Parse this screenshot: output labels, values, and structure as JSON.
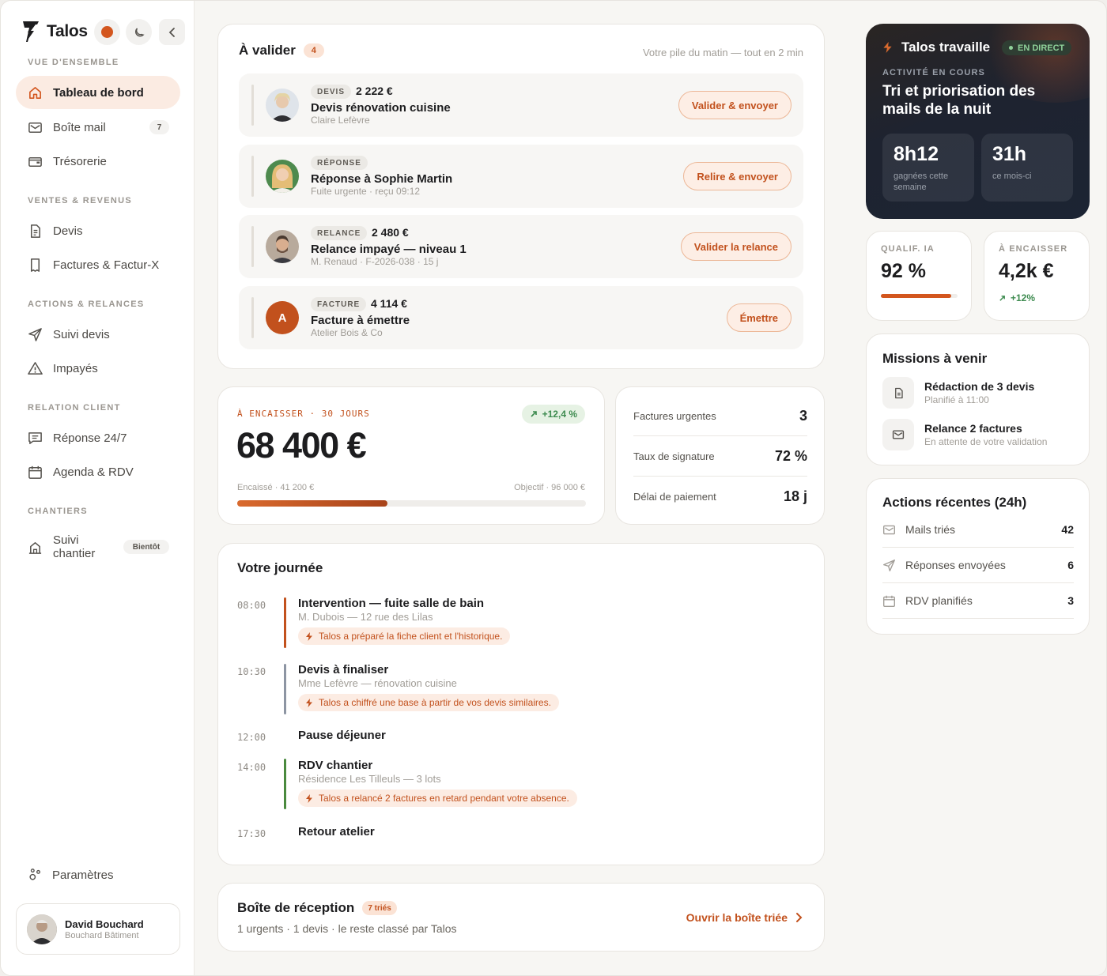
{
  "app": {
    "name": "Talos"
  },
  "sidebar": {
    "sections": [
      "VUE D'ENSEMBLE",
      "VENTES & REVENUS",
      "ACTIONS & RELANCES",
      "RELATION CLIENT",
      "CHANTIERS"
    ],
    "items": [
      {
        "label": "Tableau de bord"
      },
      {
        "label": "Boîte mail",
        "badge": "7"
      },
      {
        "label": "Trésorerie"
      },
      {
        "label": "Devis"
      },
      {
        "label": "Factures & Factur-X"
      },
      {
        "label": "Suivi devis"
      },
      {
        "label": "Impayés"
      },
      {
        "label": "Réponse 24/7"
      },
      {
        "label": "Agenda & RDV"
      },
      {
        "label": "Suivi\nchantier",
        "badge": "Bientôt"
      }
    ],
    "settings_label": "Paramètres",
    "user": {
      "name": "David Bouchard",
      "company": "Bouchard Bâtiment"
    }
  },
  "validate": {
    "title": "À valider",
    "count": "4",
    "hint": "Votre pile du matin — tout en 2 min",
    "rows": [
      {
        "tag": "DEVIS",
        "amount": "2 222 €",
        "title": "Devis rénovation cuisine",
        "sub": "Claire Lefèvre",
        "button": "Valider & envoyer"
      },
      {
        "tag": "RÉPONSE",
        "amount": "",
        "title": "Réponse à Sophie Martin",
        "sub": "Fuite urgente · reçu 09:12",
        "button": "Relire & envoyer"
      },
      {
        "tag": "RELANCE",
        "amount": "2 480 €",
        "title": "Relance impayé — niveau 1",
        "sub": "M. Renaud · F-2026-038 · 15 j",
        "button": "Valider la relance"
      },
      {
        "tag": "FACTURE",
        "amount": "4 114 €",
        "title": "Facture à émettre",
        "sub": "Atelier Bois & Co",
        "button": "Émettre",
        "avatar_letter": "A"
      }
    ]
  },
  "cash": {
    "label": "À ENCAISSER · 30 JOURS",
    "trend": "+12,4 %",
    "amount": "68 400 €",
    "collected": "Encaissé · 41 200 €",
    "target": "Objectif · 96 000 €",
    "progress": 0.43
  },
  "kpis": [
    {
      "label": "Factures urgentes",
      "value": "3"
    },
    {
      "label": "Taux de signature",
      "value": "72 %"
    },
    {
      "label": "Délai de paiement",
      "value": "18 j"
    }
  ],
  "day": {
    "title": "Votre journée",
    "events": [
      {
        "time": "08:00",
        "title": "Intervention — fuite salle de bain",
        "sub": "M. Dubois — 12 rue des Lilas",
        "note": "Talos a préparé la fiche client et l'historique."
      },
      {
        "time": "10:30",
        "title": "Devis à finaliser",
        "sub": "Mme Lefèvre — rénovation cuisine",
        "note": "Talos a chiffré une base à partir de vos devis similaires."
      },
      {
        "time": "12:00",
        "title": "Pause déjeuner"
      },
      {
        "time": "14:00",
        "title": "RDV chantier",
        "sub": "Résidence Les Tilleuls — 3 lots",
        "note": "Talos a relancé 2 factures en retard pendant votre absence."
      },
      {
        "time": "17:30",
        "title": "Retour atelier"
      }
    ],
    "colors": {
      "orange": "#c2511d",
      "slate": "#8d95a3",
      "green": "#4a8a3e"
    }
  },
  "inbox": {
    "title": "Boîte de réception",
    "badge": "7 triés",
    "summary": "1 urgents · 1 devis · le reste classé par Talos",
    "link": "Ouvrir la boîte triée"
  },
  "live": {
    "title": "Talos travaille",
    "badge": "EN DIRECT",
    "caption": "ACTIVITÉ EN COURS",
    "task": "Tri et priorisation des mails de la nuit",
    "stats": [
      {
        "value": "8h12",
        "label": "gagnées cette semaine"
      },
      {
        "value": "31h",
        "label": "ce mois-ci"
      }
    ]
  },
  "mini": [
    {
      "caption": "QUALIF. IA",
      "value": "92 %",
      "progress": 0.92
    },
    {
      "caption": "À ENCAISSER",
      "value": "4,2k €",
      "trend": "+12%"
    }
  ],
  "missions": {
    "title": "Missions à venir",
    "items": [
      {
        "title": "Rédaction de 3 devis",
        "sub": "Planifié à 11:00"
      },
      {
        "title": "Relance 2 factures",
        "sub": "En attente de votre validation"
      }
    ]
  },
  "recent": {
    "title": "Actions récentes (24h)",
    "items": [
      {
        "label": "Mails triés",
        "value": "42"
      },
      {
        "label": "Réponses envoyées",
        "value": "6"
      },
      {
        "label": "RDV planifiés",
        "value": "3"
      }
    ]
  },
  "colors": {
    "accent": "#d3561e",
    "accent_dark": "#c2511d",
    "success": "#3d8b4f"
  }
}
